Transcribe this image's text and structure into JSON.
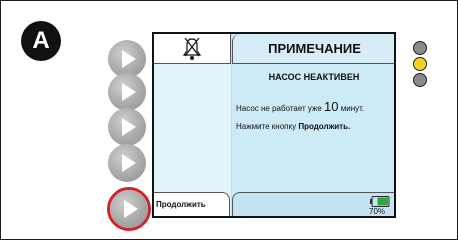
{
  "panel_label": "A",
  "screen": {
    "header_title": "ПРИМЕЧАНИЕ",
    "subheader": "НАСОС НЕАКТИВЕН",
    "message_prefix": "Насос не работает уже ",
    "message_number": "10",
    "message_suffix": " минут.",
    "instruction_prefix": "Нажмите кнопку ",
    "instruction_bold": "Продолжить.",
    "continue_key_label": "Продолжить",
    "bell_icon": "alarm-silenced-bell-icon",
    "battery": {
      "icon": "battery-icon",
      "percent_text": "70%",
      "level": 0.7,
      "color": "#2ea836"
    }
  },
  "indicator_lights": [
    {
      "name": "gray",
      "color": "#8a8a8a"
    },
    {
      "name": "yellow",
      "color": "#f2d21b"
    },
    {
      "name": "gray",
      "color": "#8a8a8a"
    }
  ],
  "side_buttons": [
    {
      "icon": "play-triangle-icon"
    },
    {
      "icon": "play-triangle-icon"
    },
    {
      "icon": "play-triangle-icon"
    },
    {
      "icon": "play-triangle-icon"
    },
    {
      "icon": "play-triangle-icon",
      "highlighted": true,
      "highlight_color": "#d2232a"
    }
  ]
}
